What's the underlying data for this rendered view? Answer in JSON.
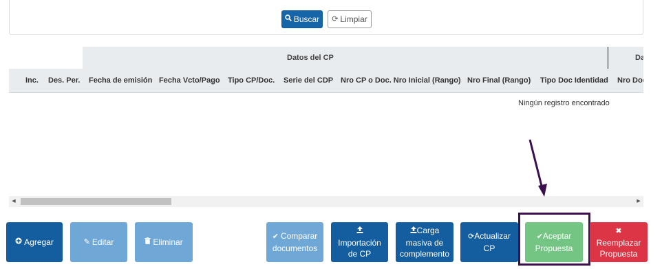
{
  "filters": {
    "search_label": "Buscar",
    "clear_label": "Limpiar"
  },
  "table": {
    "group_headers": [
      "Datos del CP",
      "Da"
    ],
    "columns": [
      "Inc.",
      "Des. Per.",
      "Fecha de emisión",
      "Fecha Vcto/Pago",
      "Tipo CP/Doc.",
      "Serie del CDP",
      "Nro CP o Doc. Nro Inicial (Rango)",
      "Nro Final (Rango)",
      "Tipo Doc Identidad",
      "Nro Doc"
    ],
    "empty_message": "Ningún registro encontrado"
  },
  "actions": {
    "add": "Agregar",
    "edit": "Editar",
    "delete": "Eliminar",
    "compare_l1": "Comparar",
    "compare_l2": "documentos",
    "import_l1": "Importación",
    "import_l2": "de CP",
    "bulk_l1": "Carga",
    "bulk_l2": "masiva de",
    "bulk_l3": "complemento",
    "update_l1": "Actualizar",
    "update_l2": "CP",
    "accept_l1": "Aceptar",
    "accept_l2": "Propuesta",
    "replace_l1": "Reemplazar",
    "replace_l2": "Propuesta"
  },
  "colors": {
    "primary": "#1565a8",
    "disabled": "#6fa7d6",
    "success": "#74c484",
    "danger": "#dc3545",
    "annotation": "#3b0f4f"
  }
}
